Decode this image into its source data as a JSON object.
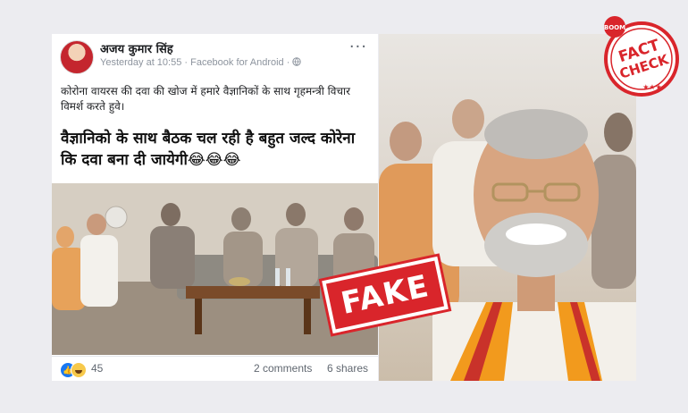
{
  "post": {
    "author": "अजय कुमार सिंह",
    "meta": "Yesterday at 10:55 · Facebook for Android · ",
    "more_label": "···",
    "text": "कोरोना वायरस की दवा की खोज में हमारे वैज्ञानिकों के साथ गृहमन्त्री विचार विमर्श करते हुवे।",
    "image_caption": "वैज्ञानिको के साथ बैठक चल रही है बहुत जल्द कोरेना कि दवा बना दी जायेगी😂😂😂",
    "reaction_count": "45",
    "comments": "2 comments",
    "shares": "6 shares"
  },
  "stamp": {
    "label": "FAKE"
  },
  "badge": {
    "top_text": "BOOM",
    "line1": "FACT",
    "line2": "CHECK",
    "color": "#d9252b"
  },
  "colors": {
    "facebook_blue": "#1877f2",
    "stamp_red": "#d9252b"
  }
}
